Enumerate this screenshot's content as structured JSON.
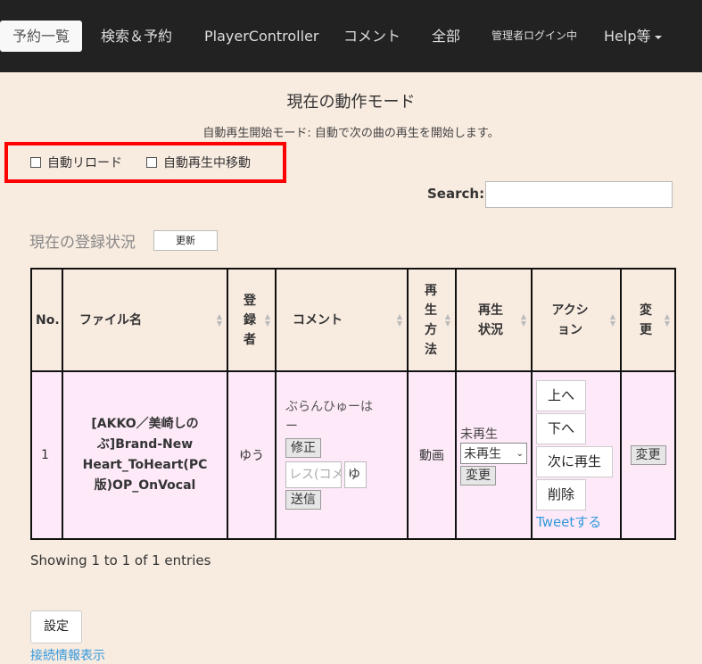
{
  "nav": {
    "items": [
      {
        "label": "予約一覧"
      },
      {
        "label": "検索＆予約"
      },
      {
        "label": "PlayerController"
      },
      {
        "label": "コメント"
      },
      {
        "label": "全部"
      },
      {
        "label": "管理者ログイン中"
      },
      {
        "label": "Help等"
      }
    ]
  },
  "mode": {
    "title": "現在の動作モード",
    "description": "自動再生開始モード: 自動で次の曲の再生を開始します。"
  },
  "options": {
    "auto_reload": "自動リロード",
    "auto_move": "自動再生中移動"
  },
  "search": {
    "label": "Search:",
    "value": ""
  },
  "status": {
    "title": "現在の登録状況",
    "update_button": "更新"
  },
  "table": {
    "headers": {
      "no": "No.",
      "filename": "ファイル名",
      "registrant": "登録者",
      "comment": "コメント",
      "method": "再生方法",
      "play_status": "再生状況",
      "action": "アクション",
      "change": "変更"
    },
    "rows": [
      {
        "no": "1",
        "filename": "[AKKO／美崎しのぶ]Brand-New Heart_ToHeart(PC版)OP_OnVocal",
        "registrant": "ゆう",
        "comment_text": "ぶらんひゅーはー",
        "comment_edit": "修正",
        "reply_placeholder": "レス(コメ",
        "reply_name": "ゆ",
        "send": "送信",
        "method": "動画",
        "play_status": "未再生",
        "status_select": "未再生",
        "status_change": "変更",
        "action_up": "上へ",
        "action_down": "下へ",
        "action_next": "次に再生",
        "action_delete": "削除",
        "tweet": "Tweetする",
        "change_button": "変更"
      }
    ]
  },
  "footer": {
    "info": "Showing 1 to 1 of 1 entries",
    "settings": "設定",
    "connection": "接続情報表示"
  }
}
